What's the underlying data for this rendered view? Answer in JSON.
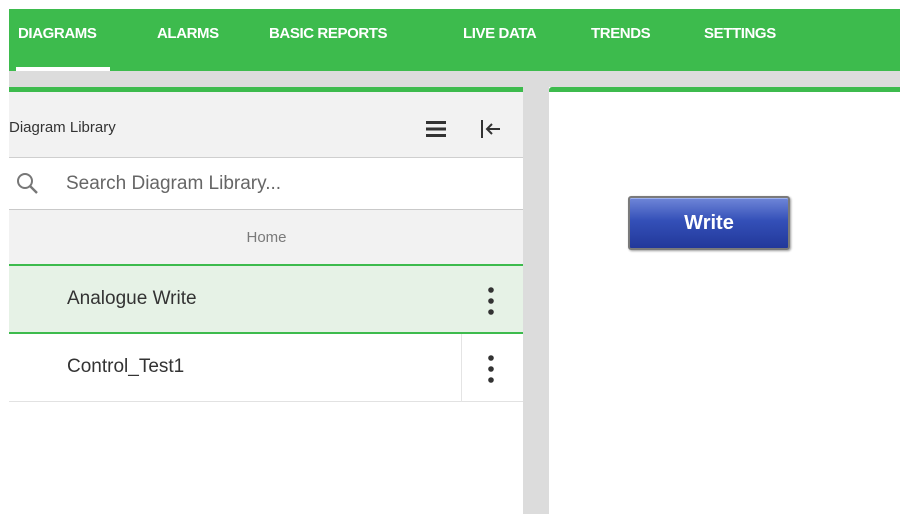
{
  "nav": {
    "tabs": [
      {
        "label": "DIAGRAMS",
        "active": true
      },
      {
        "label": "ALARMS"
      },
      {
        "label": "BASIC REPORTS"
      },
      {
        "label": "LIVE DATA"
      },
      {
        "label": "TRENDS"
      },
      {
        "label": "SETTINGS"
      }
    ]
  },
  "library": {
    "title": "Diagram Library",
    "search_placeholder": "Search Diagram Library...",
    "search_value": "",
    "breadcrumb": "Home",
    "items": [
      {
        "label": "Analogue Write",
        "selected": true
      },
      {
        "label": "Control_Test1",
        "selected": false
      }
    ]
  },
  "canvas": {
    "write_button_label": "Write"
  },
  "colors": {
    "accent": "#3dbb4d",
    "selected_row": "#e6f2e6",
    "button_blue": "#3450b8"
  },
  "icons": [
    "hamburger-menu-icon",
    "collapse-panel-icon",
    "search-icon",
    "kebab-menu-icon"
  ]
}
